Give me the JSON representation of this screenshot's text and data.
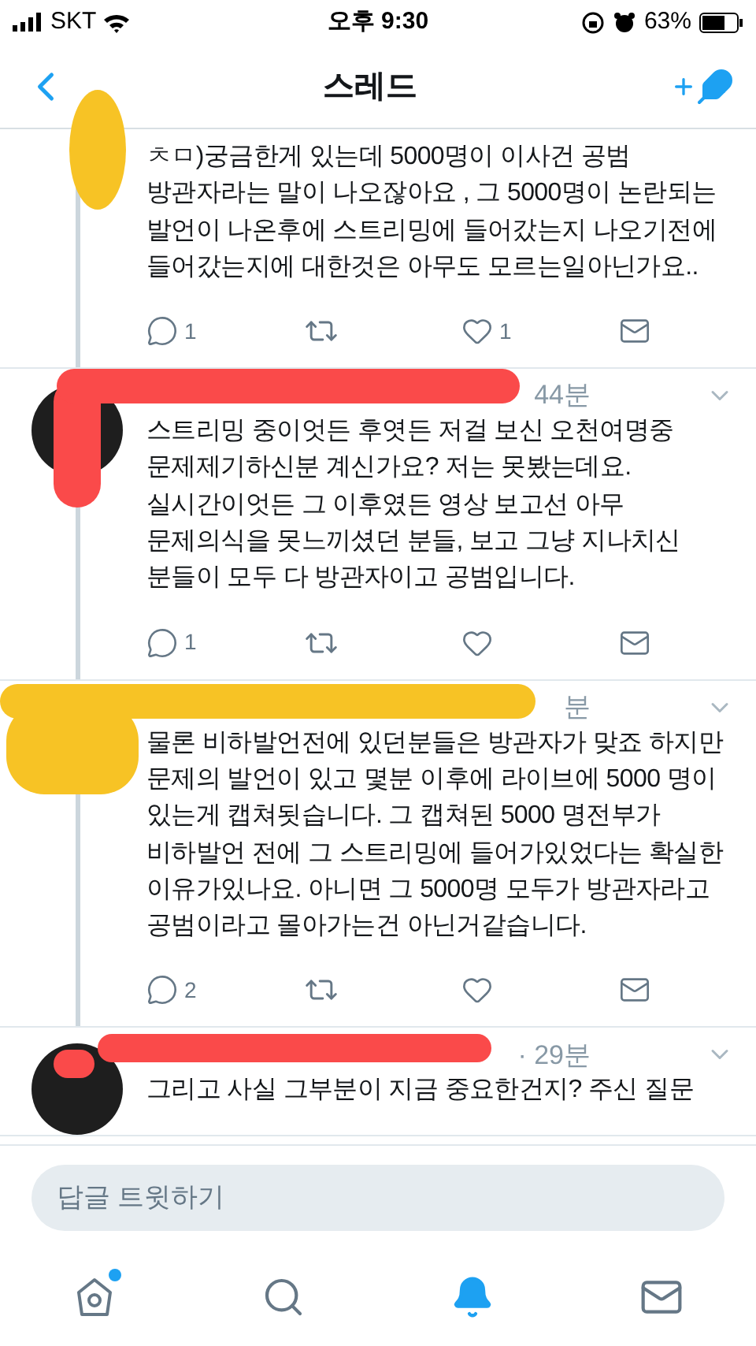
{
  "status_bar": {
    "carrier": "SKT",
    "time": "오후 9:30",
    "battery": "63%"
  },
  "header": {
    "title": "스레드"
  },
  "tweets": [
    {
      "color": "#f7c325",
      "text": "ㅊㅁ)궁금한게 있는데 5000명이 이사건 공범 방관자라는 말이 나오잖아요 , 그 5000명이 논란되는 발언이 나온후에 스트리밍에 들어갔는지 나오기전에 들어갔는지에 대한것은 아무도 모르는일아닌가요..",
      "replies": "1",
      "likes": "1"
    },
    {
      "color": "#fa4a4a",
      "time": "44분",
      "text": "스트리밍 중이엇든 후엿든 저걸 보신 오천여명중 문제제기하신분 계신가요? 저는 못봤는데요. 실시간이엇든 그 이후였든 영상 보고선 아무 문제의식을 못느끼셨던 분들, 보고 그냥 지나치신 분들이 모두 다 방관자이고 공범입니다.",
      "replies": "1"
    },
    {
      "color": "#f7c325",
      "time": "분",
      "text": "물론 비하발언전에 있던분들은 방관자가 맞죠 하지만 문제의 발언이 있고 몇분 이후에 라이브에 5000 명이 있는게 캡쳐됫습니다. 그 캡쳐된 5000 명전부가 비하발언 전에 그 스트리밍에 들어가있었다는 확실한 이유가있나요. 아니면 그 5000명 모두가 방관자라고 공범이라고 몰아가는건 아닌거같습니다.",
      "replies": "2"
    },
    {
      "color": "#fa4a4a",
      "time": "· 29분",
      "text": "그리고 사실 그부분이 지금 중요한건지? 주신 질문"
    }
  ],
  "reply_field": {
    "placeholder": "답글 트윗하기"
  },
  "nav": [
    {
      "kind": "home",
      "selected": false,
      "dot": true
    },
    {
      "kind": "search",
      "selected": false,
      "dot": false
    },
    {
      "kind": "notifications",
      "selected": true,
      "dot": false
    },
    {
      "kind": "messages",
      "selected": false,
      "dot": false
    }
  ]
}
